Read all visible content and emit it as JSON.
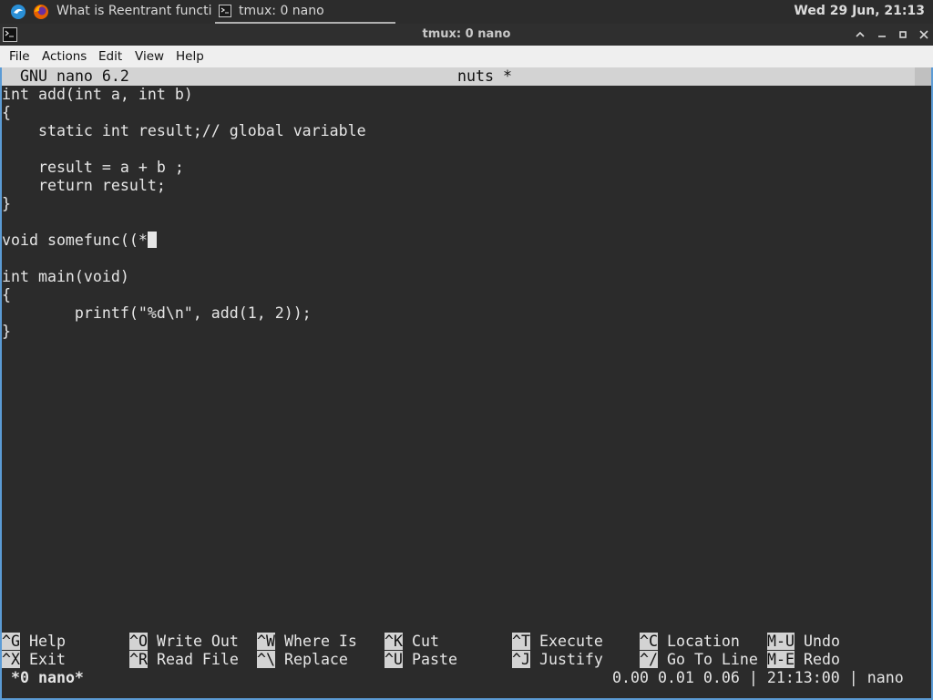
{
  "taskbar": {
    "tasks": [
      {
        "icon": "firefox-icon",
        "label": "What is Reentrant functi..."
      },
      {
        "icon": "terminal-icon",
        "label": "tmux: 0 nano"
      }
    ],
    "clock": "Wed 29 Jun, 21:13"
  },
  "window": {
    "title": "tmux: 0 nano",
    "controls": [
      "chevron-up-icon",
      "minimize-icon",
      "maximize-icon",
      "close-icon"
    ]
  },
  "menubar": {
    "items": [
      "File",
      "Actions",
      "Edit",
      "View",
      "Help"
    ]
  },
  "nano": {
    "app": "GNU nano 6.2",
    "filename": "nuts *",
    "lines": [
      "int add(int a, int b)",
      "{",
      "    static int result;// global variable",
      "",
      "    result = a + b ;",
      "    return result;",
      "}",
      "",
      "void somefunc((*",
      "",
      "int main(void)",
      "{",
      "        printf(\"%d\\n\", add(1, 2));",
      "}"
    ],
    "shortcuts_row1": [
      {
        "key": "^G",
        "label": "Help"
      },
      {
        "key": "^O",
        "label": "Write Out"
      },
      {
        "key": "^W",
        "label": "Where Is"
      },
      {
        "key": "^K",
        "label": "Cut"
      },
      {
        "key": "^T",
        "label": "Execute"
      },
      {
        "key": "^C",
        "label": "Location"
      },
      {
        "key": "M-U",
        "label": "Undo"
      }
    ],
    "shortcuts_row2": [
      {
        "key": "^X",
        "label": "Exit"
      },
      {
        "key": "^R",
        "label": "Read File"
      },
      {
        "key": "^\\",
        "label": "Replace"
      },
      {
        "key": "^U",
        "label": "Paste"
      },
      {
        "key": "^J",
        "label": "Justify"
      },
      {
        "key": "^/",
        "label": "Go To Line"
      },
      {
        "key": "M-E",
        "label": "Redo"
      }
    ]
  },
  "tmux_status": {
    "left": "*0 nano*",
    "right": "0.00 0.01 0.06 | 21:13:00 | nano"
  }
}
